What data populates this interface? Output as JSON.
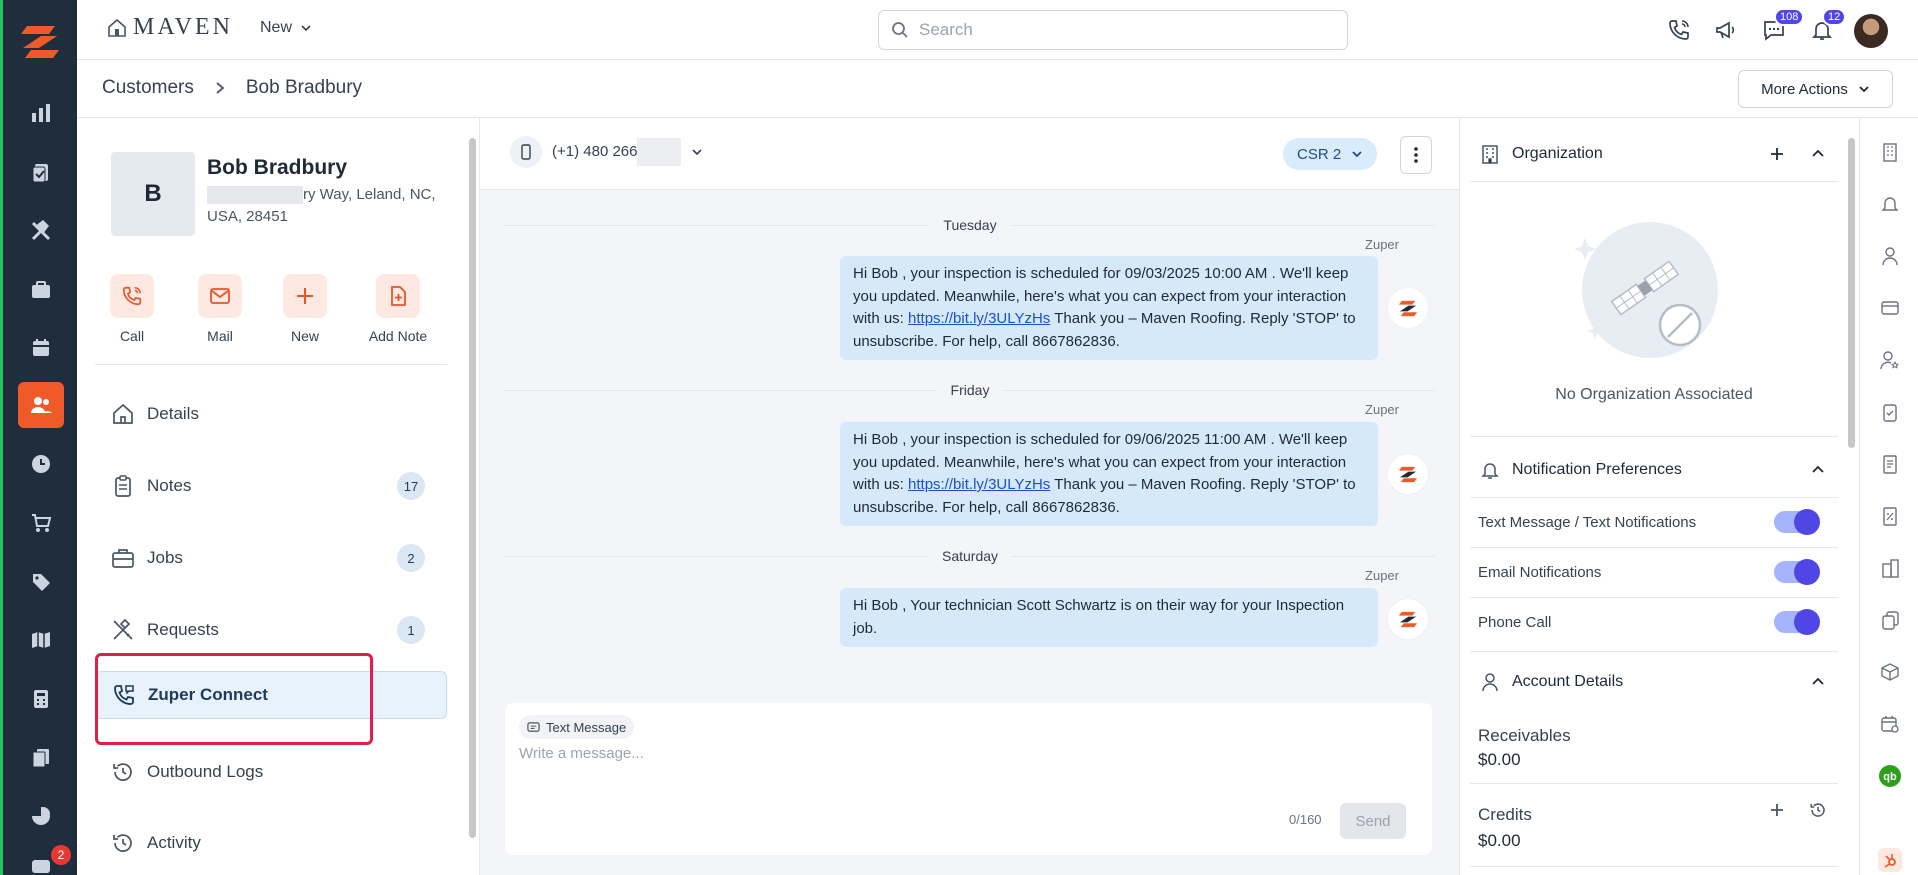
{
  "app": {
    "brand": "MAVEN",
    "new_menu_label": "New",
    "search_placeholder": "Search",
    "chat_badge": "108",
    "notif_badge": "12",
    "rail_badge": "2"
  },
  "breadcrumb": {
    "parent": "Customers",
    "current": "Bob Bradbury",
    "more_actions": "More Actions"
  },
  "customer": {
    "initial": "B",
    "name": "Bob Bradbury",
    "address_visible_part": "ry Way, Leland, NC,",
    "address_line2": "USA, 28451",
    "quick_actions": [
      {
        "label": "Call",
        "icon": "phone-icon"
      },
      {
        "label": "Mail",
        "icon": "mail-icon"
      },
      {
        "label": "New",
        "icon": "plus-icon"
      },
      {
        "label": "Add Note",
        "icon": "note-add-icon"
      }
    ],
    "nav": [
      {
        "label": "Details",
        "icon": "home-icon"
      },
      {
        "label": "Notes",
        "icon": "clipboard-icon",
        "count": "17"
      },
      {
        "label": "Jobs",
        "icon": "briefcase-icon",
        "count": "2"
      },
      {
        "label": "Requests",
        "icon": "tools-icon",
        "count": "1"
      },
      {
        "label": "Zuper Connect",
        "icon": "phone-connect-icon",
        "active": true
      },
      {
        "label": "Outbound Logs",
        "icon": "history-icon"
      },
      {
        "label": "Activity",
        "icon": "history-icon"
      }
    ]
  },
  "conversation": {
    "phone_visible": "(+1) 480 266",
    "csr_label": "CSR 2",
    "days": [
      {
        "label": "Tuesday"
      },
      {
        "label": "Friday"
      },
      {
        "label": "Saturday"
      }
    ],
    "messages": [
      {
        "sender": "Zuper",
        "text_before_link": "Hi Bob , your inspection is scheduled for 09/03/2025 10:00 AM . We'll keep you updated. Meanwhile, here's what you can expect from your interaction with us: ",
        "link": "https://bit.ly/3ULYzHs",
        "text_after_link": " Thank you – Maven Roofing. Reply 'STOP' to unsubscribe. For help, call 8667862836."
      },
      {
        "sender": "Zuper",
        "text_before_link": "Hi Bob , your inspection is scheduled for 09/06/2025 11:00 AM . We'll keep you updated. Meanwhile, here's what you can expect from your interaction with us: ",
        "link": "https://bit.ly/3ULYzHs",
        "text_after_link": " Thank you – Maven Roofing. Reply 'STOP' to unsubscribe. For help, call 8667862836."
      },
      {
        "sender": "Zuper",
        "text_before_link": "Hi Bob , Your technician Scott Schwartz is on their way for your Inspection job.",
        "link": "",
        "text_after_link": ""
      }
    ],
    "composer": {
      "channel": "Text Message",
      "placeholder": "Write a message...",
      "char_count": "0/160",
      "send_label": "Send"
    }
  },
  "right_panel": {
    "organization": {
      "title": "Organization",
      "empty_text": "No Organization Associated"
    },
    "notification_preferences": {
      "title": "Notification Preferences",
      "items": [
        {
          "label": "Text Message / Text Notifications",
          "enabled": true
        },
        {
          "label": "Email Notifications",
          "enabled": true
        },
        {
          "label": "Phone Call",
          "enabled": true
        }
      ]
    },
    "account_details": {
      "title": "Account Details",
      "receivables_label": "Receivables",
      "receivables_value": "$0.00",
      "credits_label": "Credits",
      "credits_value": "$0.00"
    }
  },
  "colors": {
    "rail_bg": "#1f2d3d",
    "accent_orange": "#f05a28",
    "bubble_bg": "#d6e9fb",
    "toggle_on": "#4f46e5",
    "highlight_red": "#e11d48"
  }
}
